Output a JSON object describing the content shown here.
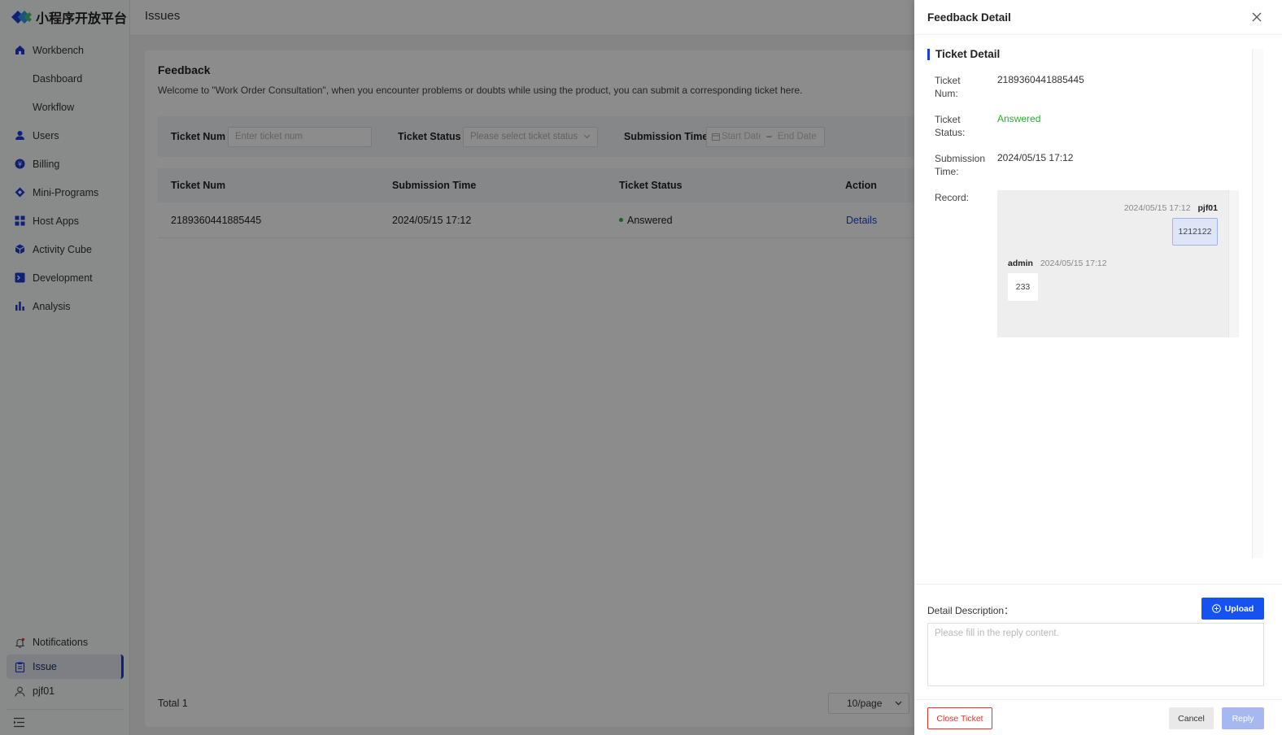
{
  "brand": {
    "name": "小程序开放平台"
  },
  "sidebar": {
    "items": [
      {
        "label": "Workbench",
        "icon": "home-icon"
      },
      {
        "label": "Dashboard",
        "icon": ""
      },
      {
        "label": "Workflow",
        "icon": ""
      },
      {
        "label": "Users",
        "icon": "user-icon"
      },
      {
        "label": "Billing",
        "icon": "billing-icon"
      },
      {
        "label": "Mini-Programs",
        "icon": "diamond-icon"
      },
      {
        "label": "Host Apps",
        "icon": "grid-icon"
      },
      {
        "label": "Activity Cube",
        "icon": "cube-icon"
      },
      {
        "label": "Development",
        "icon": "terminal-icon"
      },
      {
        "label": "Analysis",
        "icon": "bar-chart-icon"
      }
    ],
    "bottom": [
      {
        "label": "Notifications",
        "icon": "bell-icon"
      },
      {
        "label": "Issue",
        "icon": "clipboard-icon",
        "active": true
      },
      {
        "label": "pjf01",
        "icon": "user-outline-icon"
      }
    ]
  },
  "header": {
    "title": "Issues"
  },
  "feedback": {
    "title": "Feedback",
    "description": "Welcome to \"Work Order Consultation\", when you encounter problems or doubts while using the product, you can submit a corresponding ticket here.",
    "filters": {
      "ticket_num_label": "Ticket Num",
      "ticket_num_placeholder": "Enter ticket num",
      "status_label": "Ticket Status",
      "status_placeholder": "Please select ticket status",
      "time_label": "Submission Time",
      "start_placeholder": "Start Date",
      "end_placeholder": "End Date",
      "range_sep": "–"
    },
    "table": {
      "columns": [
        "Ticket Num",
        "Submission Time",
        "Ticket Status",
        "Action"
      ],
      "rows": [
        {
          "ticket_num": "2189360441885445",
          "submission_time": "2024/05/15 17:12",
          "status": "Answered",
          "action": "Details"
        }
      ]
    },
    "total": "Total 1",
    "page_size": "10/page"
  },
  "drawer": {
    "title": "Feedback Detail",
    "section_title": "Ticket Detail",
    "fields": {
      "ticket_num_label": "Ticket Num:",
      "ticket_num": "2189360441885445",
      "status_label": "Ticket Status:",
      "status": "Answered",
      "time_label": "Submission Time:",
      "time": "2024/05/15 17:12",
      "record_label": "Record:"
    },
    "record": [
      {
        "author": "pjf01",
        "time": "2024/05/15 17:12",
        "content": "1212122",
        "side": "right"
      },
      {
        "author": "admin",
        "time": "2024/05/15 17:12",
        "content": "233",
        "side": "left"
      }
    ],
    "detail_label": "Detail Description：",
    "upload_label": "Upload",
    "reply_placeholder": "Please fill in the reply content.",
    "close_ticket_label": "Close Ticket",
    "cancel_label": "Cancel",
    "reply_label": "Reply"
  },
  "colors": {
    "accent": "#1652f0",
    "success": "#25b02f",
    "danger": "#e3322c"
  }
}
